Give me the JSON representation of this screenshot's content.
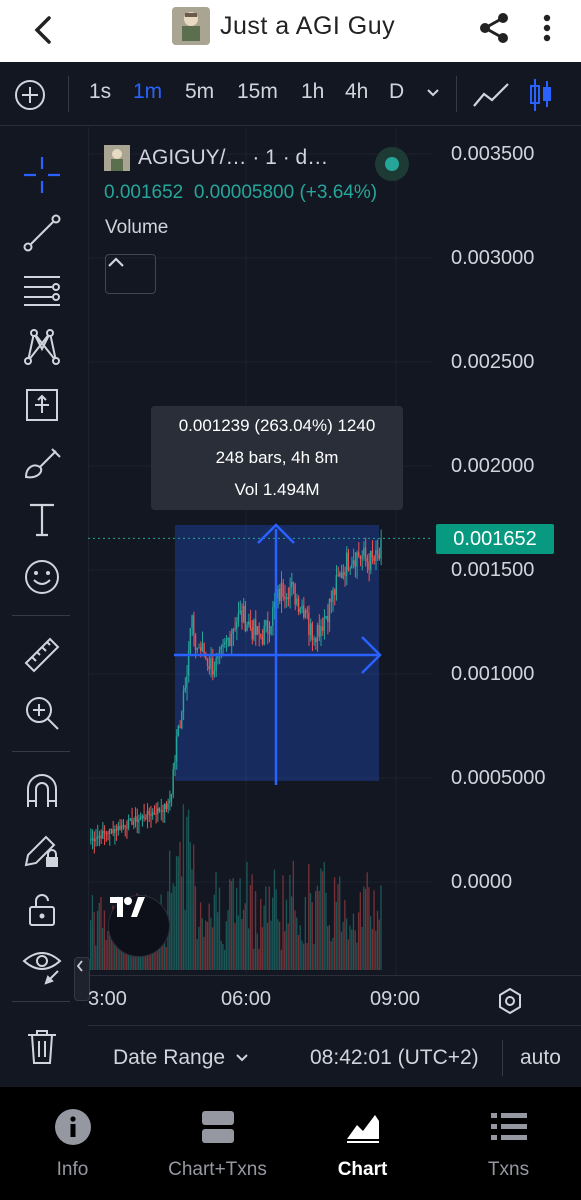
{
  "header": {
    "title": "Just a AGI Guy",
    "back_icon": "chevron-left-icon",
    "share_icon": "share-icon",
    "more_icon": "more-vertical-icon"
  },
  "intervals": {
    "items": [
      "1s",
      "1m",
      "5m",
      "15m",
      "1h",
      "4h",
      "D"
    ],
    "active": "1m"
  },
  "legend": {
    "symbol": "AGIGUY/… · 1 · d…",
    "price": "0.001652",
    "change": "0.00005800 (+3.64%)",
    "volume_label": "Volume"
  },
  "measure": {
    "line1": "0.001239 (263.04%) 1240",
    "line2": "248 bars, 4h 8m",
    "line3": "Vol 1.494M"
  },
  "price_axis": [
    "0.003500",
    "0.003000",
    "0.002500",
    "0.002000",
    "0.001500",
    "0.001000",
    "0.0005000",
    "0.0000"
  ],
  "last_price": "0.001652",
  "time_axis": [
    "3:00",
    "06:00",
    "09:00"
  ],
  "bottom_toolbar": {
    "date_range": "Date Range",
    "clock": "08:42:01 (UTC+2)",
    "auto": "auto"
  },
  "nav": [
    {
      "label": "Info",
      "icon": "info-icon"
    },
    {
      "label": "Chart+Txns",
      "icon": "split-view-icon"
    },
    {
      "label": "Chart",
      "icon": "area-chart-icon"
    },
    {
      "label": "Txns",
      "icon": "list-icon"
    }
  ],
  "colors": {
    "background": "#131722",
    "accent": "#2962ff",
    "up": "#26a69a",
    "down": "#ef5350",
    "last_price_bg": "#089981"
  }
}
